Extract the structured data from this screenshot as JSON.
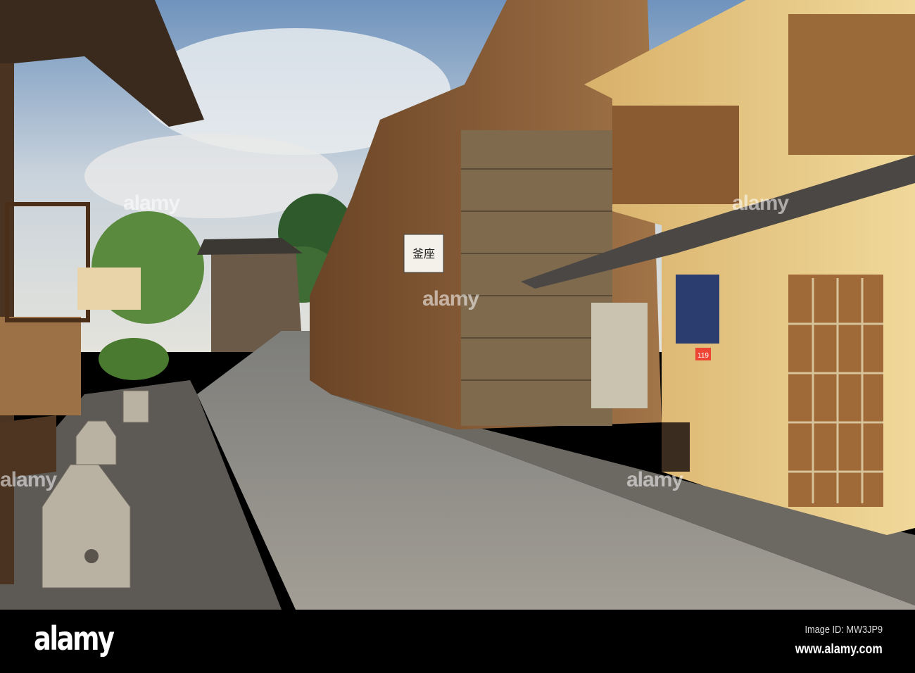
{
  "photo": {
    "subject": "Kyoto street",
    "shop_sign": "釜座",
    "emergency_sign": "119"
  },
  "footer": {
    "logo": "alamy",
    "image_id": "Image ID: MW3JP9",
    "url": "www.alamy.com"
  },
  "watermark": "alamy",
  "colors": {
    "sky": "#9fb6cc",
    "wood": "#7a5230",
    "stone": "#8d8a84",
    "footer": "#000000"
  }
}
